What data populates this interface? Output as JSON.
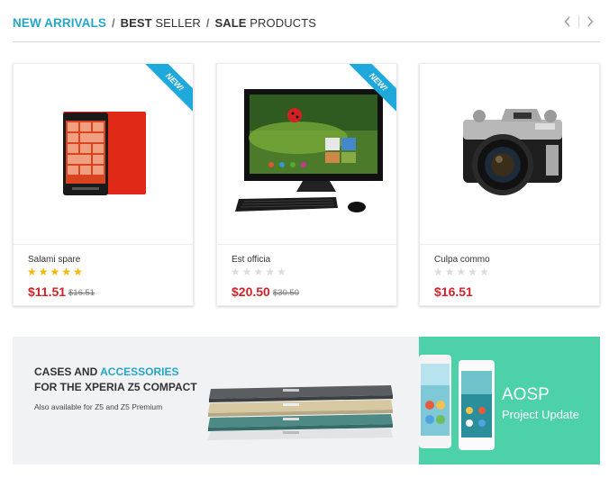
{
  "tabs": {
    "new_arrivals": "NEW ARRIVALS",
    "separator": "/",
    "best_seller_bold": "BEST",
    "best_seller_rest": " SELLER",
    "sale_bold": "SALE",
    "sale_rest": " PRODUCTS",
    "prev_icon": "chevron-left-icon",
    "next_icon": "chevron-right-icon"
  },
  "colors": {
    "accent": "#25a6c9",
    "price_red": "#d2232a",
    "star_gold": "#f7b500",
    "ribbon_blue": "#1fa8dc",
    "banner_green": "#4cd1a8"
  },
  "products": [
    {
      "name": "Salami spare",
      "price": "$11.51",
      "old_price": "$16.51",
      "rating": 5,
      "badge": "NEW!",
      "image_icon": "smartphone-icon"
    },
    {
      "name": "Est officia",
      "price": "$20.50",
      "old_price": "$30.50",
      "rating": 0,
      "badge": "NEW!",
      "image_icon": "all-in-one-computer-icon"
    },
    {
      "name": "Culpa commo",
      "price": "$16.51",
      "old_price": "",
      "rating": 0,
      "badge": "",
      "image_icon": "camera-icon"
    }
  ],
  "banner_left": {
    "line1_a": "CASES AND ",
    "line1_b": "ACCESSORIES",
    "line2": "FOR THE XPERIA Z5 COMPACT",
    "subtitle": "Also available for Z5 and Z5 Premium",
    "image_icon": "stacked-phones-icon"
  },
  "banner_right": {
    "title": "AOSP",
    "subtitle": "Project Update",
    "image_icon": "android-phones-icon"
  }
}
